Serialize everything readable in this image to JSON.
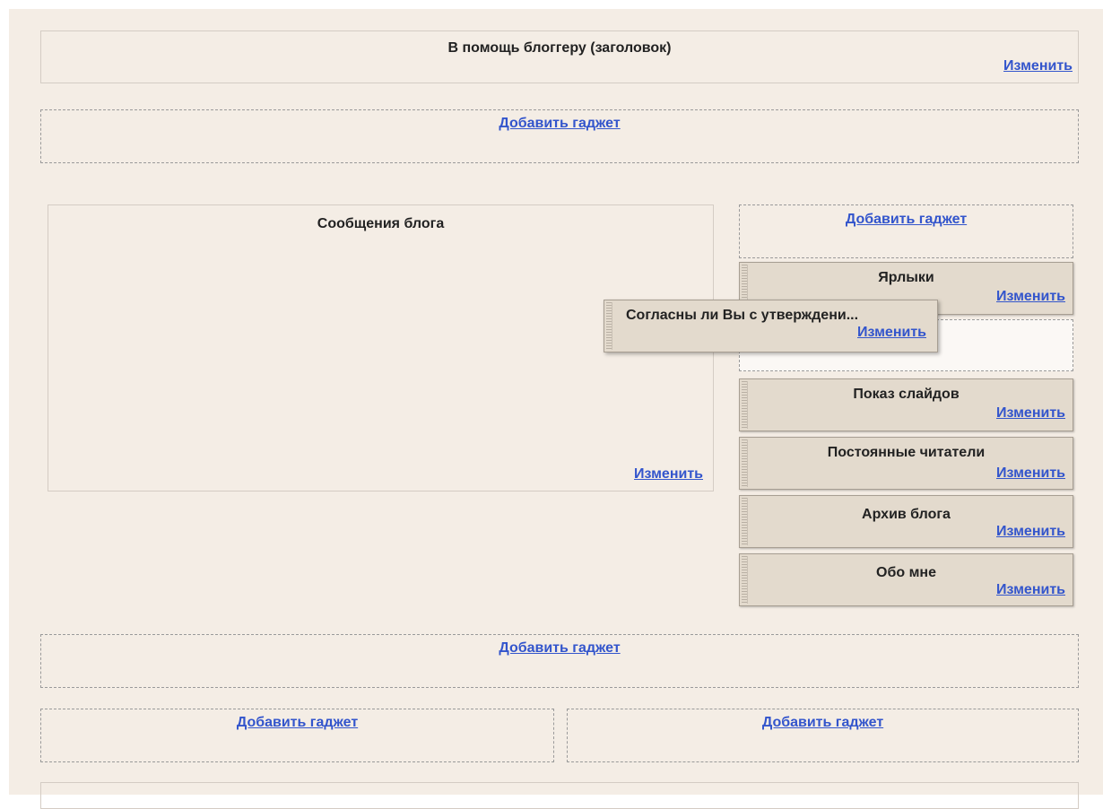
{
  "header": {
    "title": "В помощь блоггеру (заголовок)",
    "edit_label": "Изменить"
  },
  "top_add_gadget": "Добавить гаджет",
  "main": {
    "title": "Сообщения блога",
    "edit_label": "Изменить"
  },
  "sidebar": {
    "add_gadget": "Добавить гаджет",
    "gadgets": [
      {
        "title": "Ярлыки",
        "edit_label": "Изменить"
      },
      {
        "title": "Показ слайдов",
        "edit_label": "Изменить"
      },
      {
        "title": "Постоянные читатели",
        "edit_label": "Изменить"
      },
      {
        "title": "Архив блога",
        "edit_label": "Изменить"
      },
      {
        "title": "Обо мне",
        "edit_label": "Изменить"
      }
    ]
  },
  "dragging_gadget": {
    "title": "Согласны ли Вы с утверждени...",
    "edit_label": "Изменить"
  },
  "bottom_add_gadget": "Добавить гаджет",
  "footer": {
    "left_add_gadget": "Добавить гаджет",
    "right_add_gadget": "Добавить гаджет"
  }
}
